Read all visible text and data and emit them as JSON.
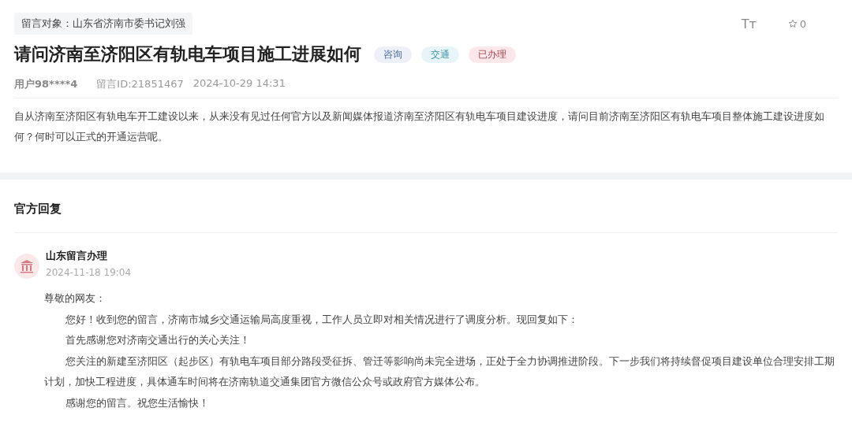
{
  "message": {
    "target_label": "留言对象：山东省济南市委书记刘强",
    "title": "请问济南至济阳区有轨电车项目施工进展如何",
    "tags": [
      {
        "label": "咨询",
        "color": "#edf1f7"
      },
      {
        "label": "交通",
        "color": "#e8f5f8"
      },
      {
        "label": "已办理",
        "color": "#fce8ea"
      }
    ],
    "font_size_button": "Tт",
    "favorites": "0",
    "user": "用户98****4",
    "message_id": "留言ID:21851467",
    "time": "2024-10-29 14:31",
    "body": "自从济南至济阳区有轨电车开工建设以来，从来没有见过任何官方以及新闻媒体报道济南至济阳区有轨电车项目建设进度，请问目前济南至济阳区有轨电车项目整体施工建设进度如何？何时可以正式的开通运营呢。"
  },
  "reply": {
    "section_title": "官方回复",
    "author": "山东留言办理",
    "time": "2024-11-18 19:04",
    "paragraphs": [
      {
        "kind": "greeting",
        "text": "尊敬的网友："
      },
      {
        "kind": "body",
        "text": "您好！收到您的留言，济南市城乡交通运输局高度重视，工作人员立即对相关情况进行了调度分析。现回复如下："
      },
      {
        "kind": "body",
        "text": "首先感谢您对济南交通出行的关心关注！"
      },
      {
        "kind": "body",
        "text": "您关注的新建至济阳区（起步区）有轨电车项目部分路段受征拆、管迁等影响尚未完全进场，正处于全力协调推进阶段。下一步我们将持续督促项目建设单位合理安排工期计划，加快工程进度，具体通车时间将在济南轨道交通集团官方微信公众号或政府官方媒体公布。"
      },
      {
        "kind": "body",
        "text": "感谢您的留言。祝您生活愉快！"
      }
    ]
  }
}
